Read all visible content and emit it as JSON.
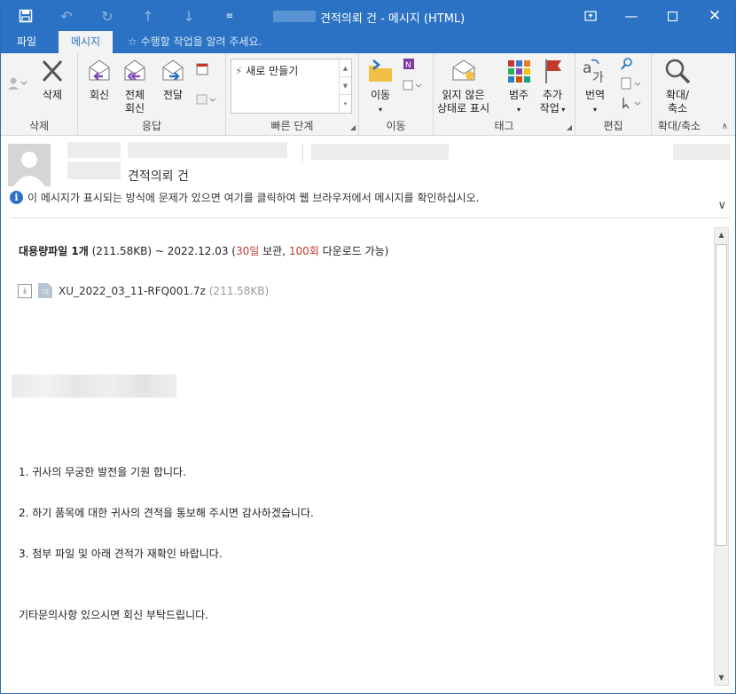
{
  "window": {
    "title": "견적의뢰 건 - 메시지 (HTML)",
    "accent": "#2b72c4"
  },
  "qat": {
    "icons": [
      "save-icon",
      "undo-icon",
      "redo-icon",
      "up-arrow-icon",
      "down-arrow-icon",
      "customize-icon"
    ]
  },
  "tabs": [
    {
      "label": "파일",
      "active": false
    },
    {
      "label": "메시지",
      "active": true
    }
  ],
  "tell_me": "수행할 작업을 알려 주세요.",
  "ribbon": {
    "groups": {
      "delete": "삭제",
      "respond": "응답",
      "quick_steps": "빠른 단계",
      "move": "이동",
      "tags": "태그",
      "editing": "편집",
      "zoom": "확대/축소"
    },
    "buttons": {
      "delete": "삭제",
      "reply": "회신",
      "reply_all_1": "전체",
      "reply_all_2": "회신",
      "forward": "전달",
      "quick_new": "새로 만들기",
      "move": "이동",
      "unread_1": "읽지 않은",
      "unread_2": "상태로 표시",
      "categorize": "범주",
      "followup_1": "추가",
      "followup_2": "작업",
      "translate": "번역",
      "zoom_1": "확대/",
      "zoom_2": "축소"
    }
  },
  "message": {
    "subject": "견적의뢰 건",
    "info_bar": "이 메시지가 표시되는 방식에 문제가 있으면 여기를 클릭하여 웹 브라우저에서 메시지를 확인하십시오.",
    "bulk_attachment": {
      "label": "대용량파일 1개",
      "size": "(211.58KB)",
      "range": "~ 2022.12.03 (",
      "days": "30일",
      "keep": " 보관, ",
      "count": "100회",
      "tail": " 다운로드 가능)"
    },
    "file": {
      "name": "XU_2022_03_11-RFQ001.7z",
      "size": "(211.58KB)",
      "ext": "7Z"
    },
    "paragraphs": [
      "1. 귀사의 무궁한 발전을 기원 합니다.",
      "2. 하기 품목에 대한 귀사의 견적을 통보해 주시면 감사하겠습니다.",
      "3. 첨부 파일 및 아래  견적가 재확인 바랍니다.",
      "기타문의사항 있으시면 회신 부탁드립니다."
    ]
  }
}
